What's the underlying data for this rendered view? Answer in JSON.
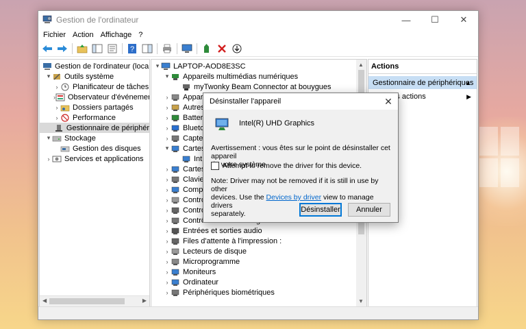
{
  "window": {
    "title": "Gestion de l'ordinateur"
  },
  "menu": [
    "Fichier",
    "Action",
    "Affichage",
    "?"
  ],
  "left_tree": {
    "root": "Gestion de l'ordinateur (local)",
    "tools": "Outils système",
    "tasks": "Planificateur de tâches",
    "events": "Observateur d'événemer",
    "shared": "Dossiers partagés",
    "perf": "Performance",
    "devmgr": "Gestionnaire de périphér",
    "storage": "Stockage",
    "disk": "Gestion des disques",
    "services": "Services et applications"
  },
  "device_tree": {
    "root": "LAPTOP-AOD8E3SC",
    "multimedia": "Appareils multimédias numériques",
    "mytwonky": "myTwonky Beam Connector at bouygues",
    "items": [
      "Appar",
      "Autres",
      "Batter",
      "Blueto",
      "Captei",
      "Cartes",
      "Int",
      "Cartes",
      "Clavie",
      "Comp",
      "Contro",
      "Contro",
      "Contrôleurs de stockage",
      "Entrées et sorties audio",
      "Files d'attente à l'impression :",
      "Lecteurs de disque",
      "Microprogramme",
      "Moniteurs",
      "Ordinateur",
      "Périphériques biométriques"
    ]
  },
  "actions": {
    "header": "Actions",
    "selected": "Gestionnaire de périphériques",
    "more": "Autres actions"
  },
  "dialog": {
    "title": "Désinstaller l'appareil",
    "device": "Intel(R) UHD Graphics",
    "warning_line1": "Avertissement : vous êtes sur le point de désinstaller cet appareil",
    "warning_line2": "de votre système.",
    "checkbox_label": "Attempt to remove the driver for this device.",
    "note_line1": "Note: Driver may not be removed if it is still in use by other",
    "note_line2_pre": "devices. Use the",
    "note_link": "Devices by driver",
    "note_line2_post": "view to manage drivers",
    "note_line3": "separately.",
    "uninstall_button": "Désinstaller",
    "cancel_button": "Annuler"
  },
  "colors": {
    "accent": "#0078d7",
    "selection": "#c7def4",
    "dialog_bg": "#f0f0f0"
  }
}
